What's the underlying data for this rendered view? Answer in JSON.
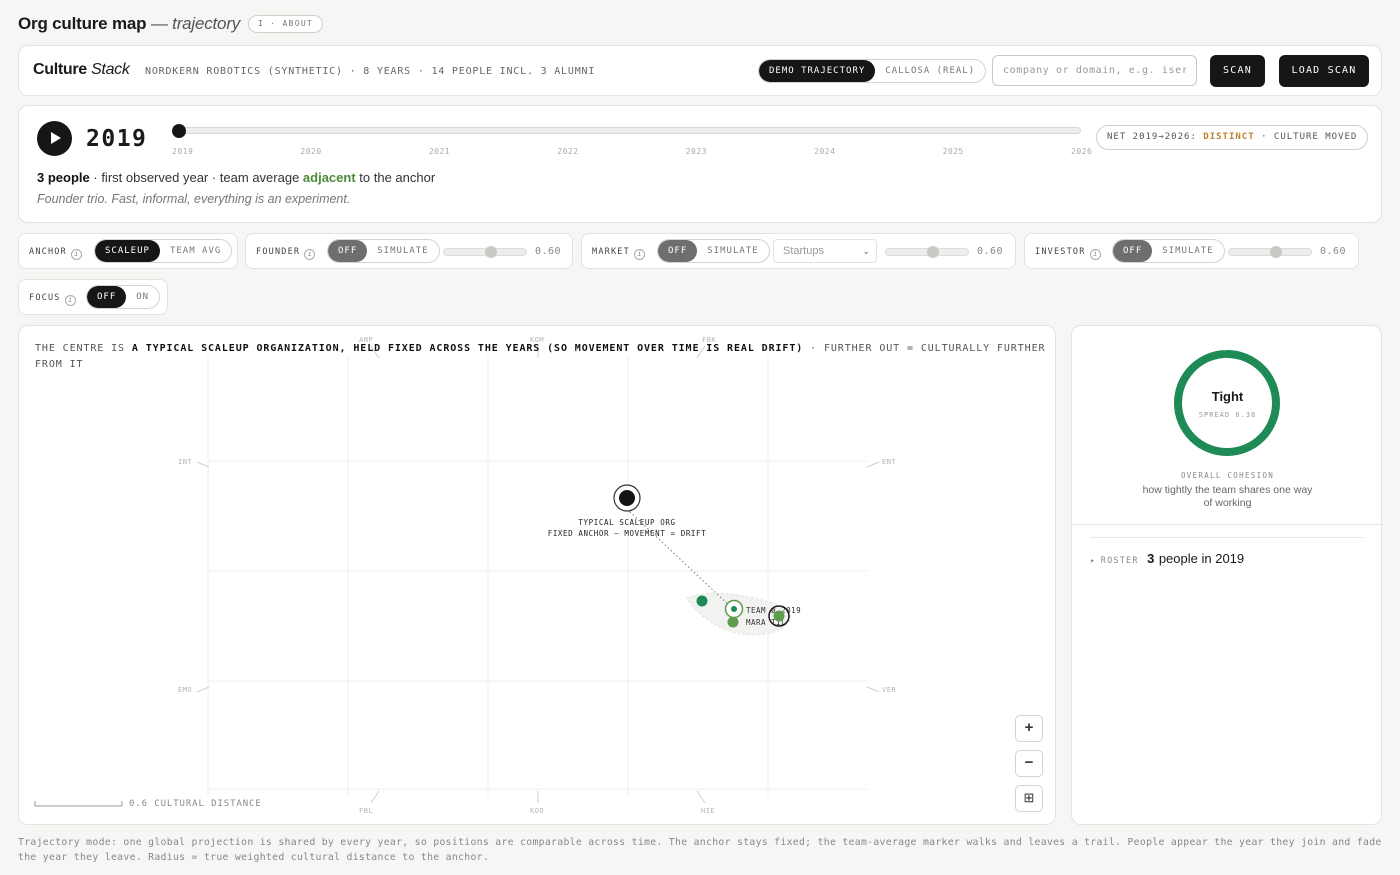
{
  "app": {
    "title": "Org culture map",
    "title_suffix": "— trajectory",
    "about_label": "I · ABOUT"
  },
  "topbar": {
    "brand_main": "Culture",
    "brand_italic": "Stack",
    "meta": "NORDKERN ROBOTICS (SYNTHETIC) · 8 YEARS · 14 PEOPLE INCL. 3 ALUMNI",
    "data_options": [
      "DEMO TRAJECTORY",
      "CALLOSA (REAL)"
    ],
    "search_placeholder": "company or domain, e.g. iserv.eu",
    "scan_label": "SCAN",
    "load_scan_label": "LOAD SCAN"
  },
  "timeline": {
    "year": "2019",
    "current_fraction": 0.0,
    "ticks": [
      "2019",
      "2020",
      "2021",
      "2022",
      "2023",
      "2024",
      "2025",
      "2026"
    ],
    "net_prefix": "NET 2019→2026:",
    "net_value": "DISTINCT",
    "net_suffix": "· CULTURE MOVED",
    "summary_count": "3 people",
    "summary_mid": "· first observed year · team average",
    "summary_adj": "adjacent",
    "summary_end": "to the anchor",
    "note": "Founder trio. Fast, informal, everything is an experiment."
  },
  "controls": {
    "anchor": {
      "label": "ANCHOR",
      "options": [
        "SCALEUP",
        "TEAM AVG"
      ]
    },
    "founder": {
      "label": "FOUNDER",
      "options": [
        "OFF",
        "SIMULATE"
      ],
      "value": "0.60"
    },
    "market": {
      "label": "MARKET",
      "options": [
        "OFF",
        "SIMULATE"
      ],
      "select_value": "Startups",
      "value": "0.60"
    },
    "investor": {
      "label": "INVESTOR",
      "options": [
        "OFF",
        "SIMULATE"
      ],
      "value": "0.60"
    },
    "focus": {
      "label": "FOCUS",
      "options": [
        "OFF",
        "ON"
      ]
    }
  },
  "map": {
    "caption_pre": "THE CENTRE IS",
    "caption_bold": "A TYPICAL SCALEUP ORGANIZATION, HELD FIXED ACROSS THE YEARS (SO MOVEMENT OVER TIME IS REAL DRIFT)",
    "caption_post": "· FURTHER OUT = CULTURALLY FURTHER FROM IT",
    "axes": [
      "ANP",
      "KOM",
      "FBK",
      "INT",
      "ENT",
      "EMO",
      "VER",
      "FBL",
      "KOO",
      "HIE"
    ],
    "anchor_label_1": "TYPICAL SCALEUP ORG",
    "anchor_label_2": "FIXED ANCHOR — MOVEMENT = DRIFT",
    "team_label": "TEAM ø 2019",
    "person_label": "MARA TIL",
    "scale_label": "0.6 CULTURAL DISTANCE",
    "zoom_in": "+",
    "zoom_out": "−",
    "fit": "⊞",
    "green": "#1e8a55",
    "green_light": "#5d9b4d"
  },
  "cohesion": {
    "word": "Tight",
    "spread": "SPREAD 0.38",
    "label": "OVERALL COHESION",
    "desc": "how tightly the team shares one way of working",
    "ring_color": "#1e8a55"
  },
  "roster": {
    "label": "ROSTER",
    "count": "3",
    "text": "people in 2019"
  },
  "footer": "Trajectory mode: one global projection is shared by every year, so positions are comparable across time. The anchor stays fixed; the team-average marker walks and leaves a trail. People appear the year they join and fade the year they leave. Radius = true weighted cultural distance to the anchor."
}
